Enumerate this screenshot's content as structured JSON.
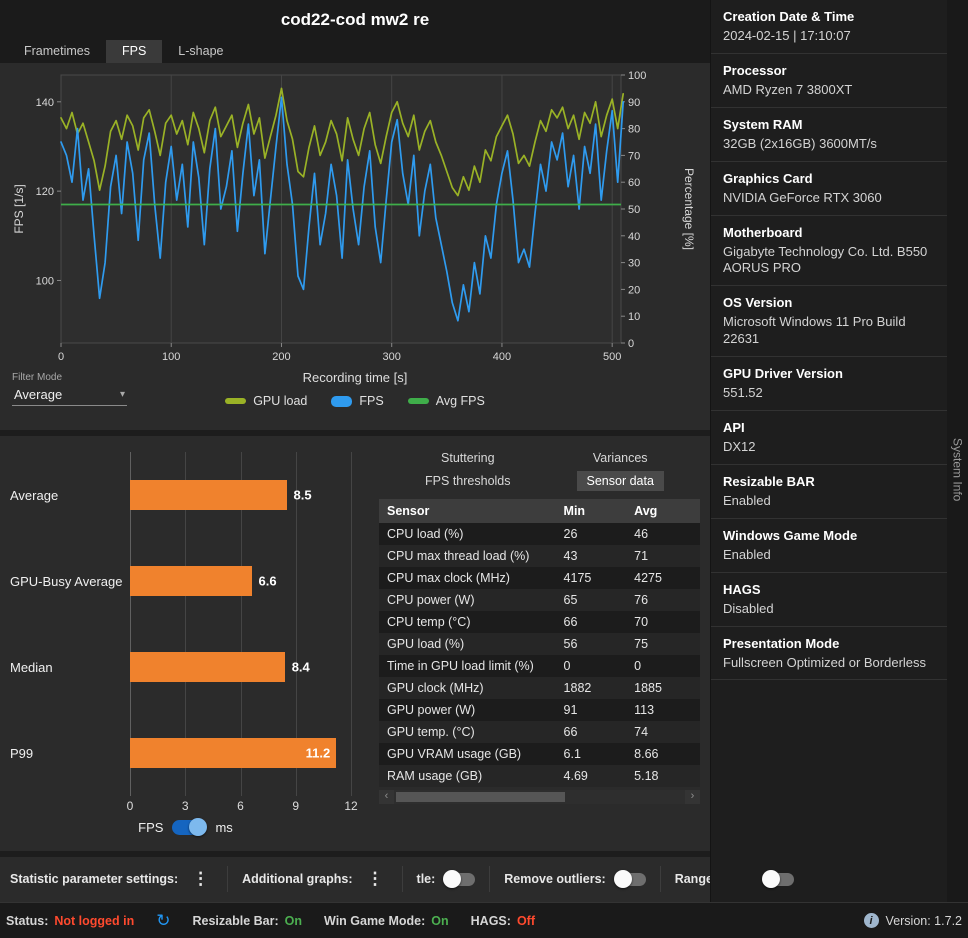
{
  "icons": {
    "kebab": "⋮",
    "refresh": "↻",
    "info": "i",
    "caret_down": "▾",
    "scroll_left": "‹",
    "scroll_right": "›"
  },
  "colors": {
    "accent_orange": "#f0822d",
    "fps_blue": "#2f9bef",
    "gpu_olive": "#9ab226",
    "avg_green": "#3fae4a",
    "status_green": "#4caf50",
    "status_red": "#ff4a2e",
    "toggle_blue": "#1565c0"
  },
  "header": {
    "title": "cod22-cod mw2 re"
  },
  "chart_tabs": [
    {
      "label": "Frametimes",
      "active": false
    },
    {
      "label": "FPS",
      "active": true
    },
    {
      "label": "L-shape",
      "active": false
    }
  ],
  "filter": {
    "label": "Filter Mode",
    "value": "Average"
  },
  "chart_data": [
    {
      "type": "line",
      "title": "cod22-cod mw2 re",
      "xlabel": "Recording time [s]",
      "ylabel_left": "FPS [1/s]",
      "ylabel_right": "Percentage [%]",
      "x_range": [
        0,
        508
      ],
      "y_left_range": [
        86,
        146
      ],
      "y_right_range": [
        0,
        100
      ],
      "x_ticks": [
        0,
        100,
        200,
        300,
        400,
        500
      ],
      "y_left_ticks": [
        100,
        120,
        140
      ],
      "y_right_ticks": [
        0,
        10,
        20,
        30,
        40,
        50,
        60,
        70,
        80,
        90,
        100
      ],
      "x_step": 5,
      "grid": "vertical",
      "legend_position": "bottom",
      "series": [
        {
          "name": "GPU load",
          "axis": "right",
          "color": "#9ab226",
          "swatch_height": 6,
          "values": [
            84,
            80,
            86,
            78,
            82,
            75,
            68,
            57,
            66,
            79,
            83,
            76,
            85,
            81,
            72,
            84,
            87,
            79,
            70,
            82,
            85,
            78,
            83,
            74,
            86,
            80,
            71,
            83,
            88,
            77,
            81,
            85,
            73,
            82,
            89,
            78,
            84,
            69,
            77,
            85,
            95,
            83,
            76,
            64,
            62,
            73,
            81,
            70,
            75,
            83,
            78,
            68,
            84,
            76,
            70,
            80,
            86,
            74,
            67,
            77,
            86,
            90,
            82,
            77,
            85,
            72,
            79,
            83,
            75,
            70,
            64,
            58,
            55,
            62,
            57,
            66,
            60,
            72,
            68,
            77,
            81,
            85,
            78,
            67,
            70,
            66,
            75,
            83,
            79,
            87,
            84,
            88,
            80,
            85,
            76,
            86,
            82,
            90,
            77,
            85,
            91,
            80,
            93
          ]
        },
        {
          "name": "FPS",
          "axis": "left",
          "color": "#2f9bef",
          "swatch_height": 11,
          "values": [
            131,
            128,
            122,
            134,
            118,
            125,
            110,
            96,
            104,
            121,
            128,
            115,
            131,
            124,
            109,
            127,
            133,
            117,
            105,
            122,
            130,
            118,
            126,
            112,
            131,
            123,
            108,
            125,
            134,
            116,
            121,
            129,
            111,
            124,
            135,
            119,
            127,
            106,
            118,
            130,
            141,
            126,
            117,
            101,
            98,
            112,
            124,
            108,
            115,
            126,
            119,
            105,
            127,
            116,
            108,
            121,
            129,
            112,
            104,
            118,
            131,
            136,
            124,
            117,
            128,
            110,
            120,
            126,
            114,
            108,
            102,
            95,
            91,
            99,
            93,
            104,
            97,
            110,
            105,
            117,
            124,
            129,
            118,
            104,
            107,
            103,
            115,
            126,
            120,
            131,
            127,
            133,
            121,
            128,
            116,
            130,
            124,
            135,
            118,
            129,
            138,
            122,
            140
          ]
        },
        {
          "name": "Avg FPS",
          "axis": "left",
          "color": "#3fae4a",
          "swatch_height": 6,
          "constant": 117
        }
      ]
    },
    {
      "type": "bar",
      "orientation": "horizontal",
      "categories": [
        "Average",
        "GPU-Busy Average",
        "Median",
        "P99"
      ],
      "values": [
        8.5,
        6.6,
        8.4,
        11.2
      ],
      "value_labels": [
        "8.5",
        "6.6",
        "8.4",
        "11.2"
      ],
      "label_inside": [
        false,
        false,
        false,
        true
      ],
      "xlim": [
        0,
        12
      ],
      "x_ticks": [
        0,
        3,
        6,
        9,
        12
      ],
      "bar_color": "#f0822d",
      "unit_left": "FPS",
      "unit_right": "ms",
      "selected_unit": "ms"
    }
  ],
  "analysis_tabs": {
    "items": [
      "Stuttering",
      "Variances",
      "FPS thresholds",
      "Sensor data"
    ],
    "active": "Sensor data"
  },
  "sensor_table": {
    "columns": [
      "Sensor",
      "Min",
      "Avg"
    ],
    "rows": [
      [
        "CPU load (%)",
        "26",
        "46"
      ],
      [
        "CPU max thread load (%)",
        "43",
        "71"
      ],
      [
        "CPU max clock (MHz)",
        "4175",
        "4275"
      ],
      [
        "CPU power (W)",
        "65",
        "76"
      ],
      [
        "CPU temp (°C)",
        "66",
        "70"
      ],
      [
        "GPU load (%)",
        "56",
        "75"
      ],
      [
        "Time in GPU load limit (%)",
        "0",
        "0"
      ],
      [
        "GPU clock (MHz)",
        "1882",
        "1885"
      ],
      [
        "GPU power (W)",
        "91",
        "113"
      ],
      [
        "GPU temp. (°C)",
        "66",
        "74"
      ],
      [
        "GPU VRAM usage (GB)",
        "6.1",
        "8.66"
      ],
      [
        "RAM usage (GB)",
        "4.69",
        "5.18"
      ]
    ]
  },
  "settings_bar": {
    "items": [
      {
        "label": "Statistic parameter settings:",
        "control": "kebab",
        "name": "statistic-parameter-settings"
      },
      {
        "label": "Additional graphs:",
        "control": "kebab",
        "name": "additional-graphs"
      },
      {
        "label": "tle:",
        "control": "toggle",
        "on": false,
        "name": "title-toggle"
      },
      {
        "label": "Remove outliers:",
        "control": "toggle",
        "on": false,
        "name": "remove-outliers-toggle"
      },
      {
        "label": "Range slider:",
        "control": "toggle",
        "on": false,
        "name": "range-slider-toggle"
      }
    ]
  },
  "status_bar": {
    "items": [
      {
        "label": "Status:",
        "value": "Not logged in",
        "color": "red"
      },
      {
        "icon": "refresh"
      },
      {
        "label": "Resizable Bar:",
        "value": "On",
        "color": "green"
      },
      {
        "label": "Win Game Mode:",
        "value": "On",
        "color": "green"
      },
      {
        "label": "HAGS:",
        "value": "Off",
        "color": "red"
      }
    ],
    "version": "Version: 1.7.2"
  },
  "sidebar": {
    "vertical_label": "System Info",
    "sections": [
      {
        "title": "Creation Date & Time",
        "value": "2024-02-15  |  17:10:07"
      },
      {
        "title": "Processor",
        "value": "AMD Ryzen 7 3800XT"
      },
      {
        "title": "System RAM",
        "value": "32GB (2x16GB) 3600MT/s"
      },
      {
        "title": "Graphics Card",
        "value": "NVIDIA GeForce RTX 3060"
      },
      {
        "title": "Motherboard",
        "value": "Gigabyte Technology Co. Ltd. B550 AORUS PRO"
      },
      {
        "title": "OS Version",
        "value": "Microsoft Windows 11 Pro Build 22631"
      },
      {
        "title": "GPU Driver Version",
        "value": "551.52"
      },
      {
        "title": "API",
        "value": "DX12"
      },
      {
        "title": "Resizable BAR",
        "value": "Enabled"
      },
      {
        "title": "Windows Game Mode",
        "value": "Enabled"
      },
      {
        "title": "HAGS",
        "value": "Disabled"
      },
      {
        "title": "Presentation Mode",
        "value": "Fullscreen Optimized or Borderless"
      }
    ]
  }
}
